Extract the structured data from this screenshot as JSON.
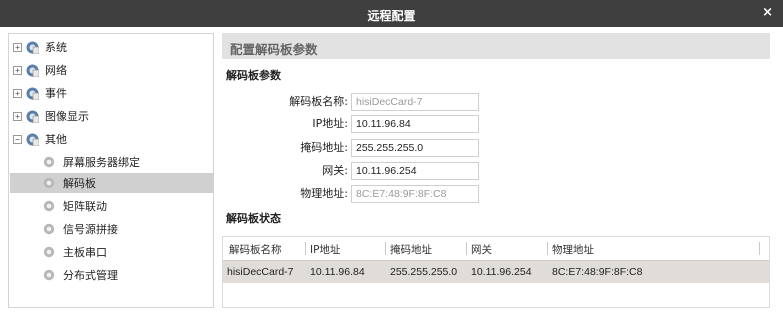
{
  "window": {
    "title": "远程配置",
    "close_label": "×"
  },
  "sidebar": {
    "items": [
      {
        "label": "系统",
        "expander": "+"
      },
      {
        "label": "网络",
        "expander": "+"
      },
      {
        "label": "事件",
        "expander": "+"
      },
      {
        "label": "图像显示",
        "expander": "+"
      },
      {
        "label": "其他",
        "expander": "−"
      }
    ],
    "children": [
      {
        "label": "屏幕服务器绑定"
      },
      {
        "label": "解码板"
      },
      {
        "label": "矩阵联动"
      },
      {
        "label": "信号源拼接"
      },
      {
        "label": "主板串口"
      },
      {
        "label": "分布式管理"
      }
    ],
    "selected": "解码板"
  },
  "main": {
    "header": "配置解码板参数",
    "params_title": "解码板参数",
    "form": {
      "name_label": "解码板名称:",
      "name_value": "hisiDecCard-7",
      "ip_label": "IP地址:",
      "ip_value": "10.11.96.84",
      "mask_label": "掩码地址:",
      "mask_value": "255.255.255.0",
      "gateway_label": "网关:",
      "gateway_value": "10.11.96.254",
      "mac_label": "物理地址:",
      "mac_value": "8C:E7:48:9F:8F:C8"
    },
    "status_title": "解码板状态",
    "table": {
      "columns": [
        "解码板名称",
        "IP地址",
        "掩码地址",
        "网关",
        "物理地址"
      ],
      "rows": [
        [
          "hisiDecCard-7",
          "10.11.96.84",
          "255.255.255.0",
          "10.11.96.254",
          "8C:E7:48:9F:8F:C8"
        ]
      ]
    }
  },
  "colors": {
    "titlebar": "#3f3f3f",
    "selected_row": "#d0d0d0",
    "table_row": "#e0dcd8",
    "header_band": "#e2e2e2"
  },
  "icons": {
    "top_node": "folder-gear-icon",
    "child_node": "gear-icon"
  }
}
